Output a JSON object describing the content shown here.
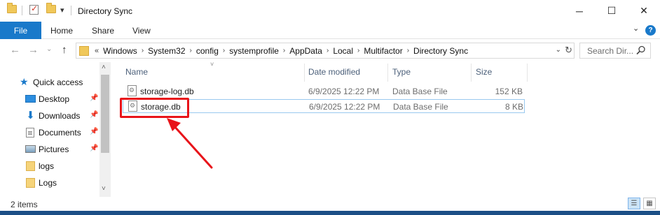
{
  "window": {
    "title": "Directory Sync",
    "controls": {
      "minimize": "─",
      "maximize": "☐",
      "close": "✕"
    }
  },
  "ribbon": {
    "tabs": [
      {
        "label": "File",
        "active": true
      },
      {
        "label": "Home"
      },
      {
        "label": "Share"
      },
      {
        "label": "View"
      }
    ],
    "expand_glyph": "⌄",
    "help_glyph": "?"
  },
  "addressbar": {
    "back_glyph": "←",
    "forward_glyph": "→",
    "recent_glyph": "⌄",
    "up_glyph": "↑",
    "overflow": "«",
    "crumbs": [
      "Windows",
      "System32",
      "config",
      "systemprofile",
      "AppData",
      "Local",
      "Multifactor",
      "Directory Sync"
    ],
    "separator_glyph": "›",
    "dropdown_glyph": "⌄",
    "refresh_glyph": "↻"
  },
  "search": {
    "placeholder": "Search Dir...",
    "icon": "search-icon"
  },
  "nav": {
    "quick_access": "Quick access",
    "items": [
      {
        "label": "Desktop",
        "icon": "desktop-icon",
        "pinned": true
      },
      {
        "label": "Downloads",
        "icon": "download-arrow-icon",
        "pinned": true
      },
      {
        "label": "Documents",
        "icon": "document-icon",
        "pinned": true
      },
      {
        "label": "Pictures",
        "icon": "pictures-icon",
        "pinned": true
      },
      {
        "label": "logs",
        "icon": "folder-icon",
        "pinned": false
      },
      {
        "label": "Logs",
        "icon": "folder-icon",
        "pinned": false
      }
    ],
    "pin_glyph": "📌",
    "scroll_up_glyph": "˄",
    "scroll_down_glyph": "˅"
  },
  "filelist": {
    "columns": [
      "Name",
      "Date modified",
      "Type",
      "Size"
    ],
    "sort_glyph": "˅",
    "rows": [
      {
        "name": "storage-log.db",
        "date": "6/9/2025 12:22 PM",
        "type": "Data Base File",
        "size": "152 KB",
        "selected": false
      },
      {
        "name": "storage.db",
        "date": "6/9/2025 12:22 PM",
        "type": "Data Base File",
        "size": "8 KB",
        "selected": true
      }
    ]
  },
  "annotation": {
    "color": "#e8141a"
  },
  "statusbar": {
    "count": "2 items",
    "details_glyph": "☰",
    "tiles_glyph": "▦"
  },
  "colors": {
    "accent": "#1979ca",
    "header_text": "#4c607a",
    "selection_border": "#99c9ef",
    "taskbar": "#1c4f86"
  }
}
